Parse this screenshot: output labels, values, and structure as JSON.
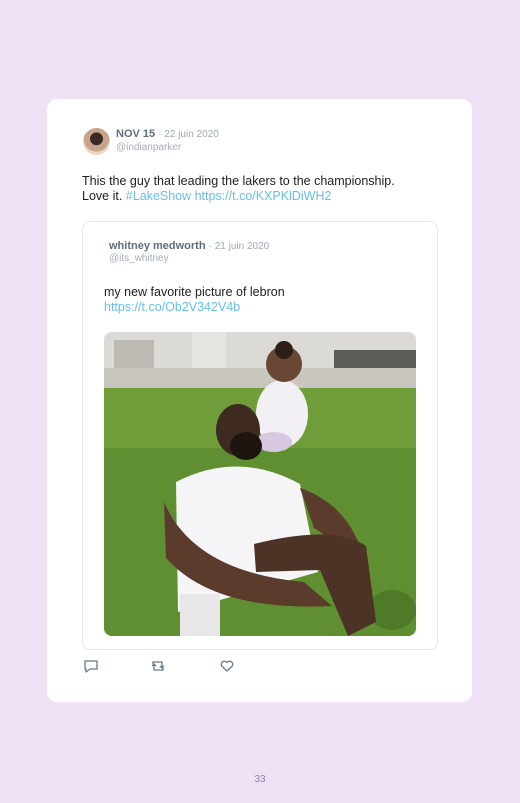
{
  "tweet": {
    "author": "NOV 15",
    "date": "· 22 juin 2020",
    "handle": "@indianparker",
    "text_line1": "This the guy that leading the lakers to the championship.",
    "text_prefix": "Love it.",
    "hashtag": "#LakeShow",
    "link": "https://t.co/KXPKlDiWH2"
  },
  "quote": {
    "author": "whitney medworth",
    "date": "· 21 juin 2020",
    "handle": "@its_whitney",
    "text": "my new favorite picture of lebron",
    "link": "https://t.co/Ob2V342V4b"
  },
  "actions": {
    "icons": [
      "reply-icon",
      "retweet-icon",
      "like-icon"
    ]
  },
  "page": {
    "number": "33"
  },
  "colors": {
    "background": "#efe2f7",
    "card": "#ffffff",
    "link": "#66c0e6",
    "name": "#5f6e7e"
  }
}
